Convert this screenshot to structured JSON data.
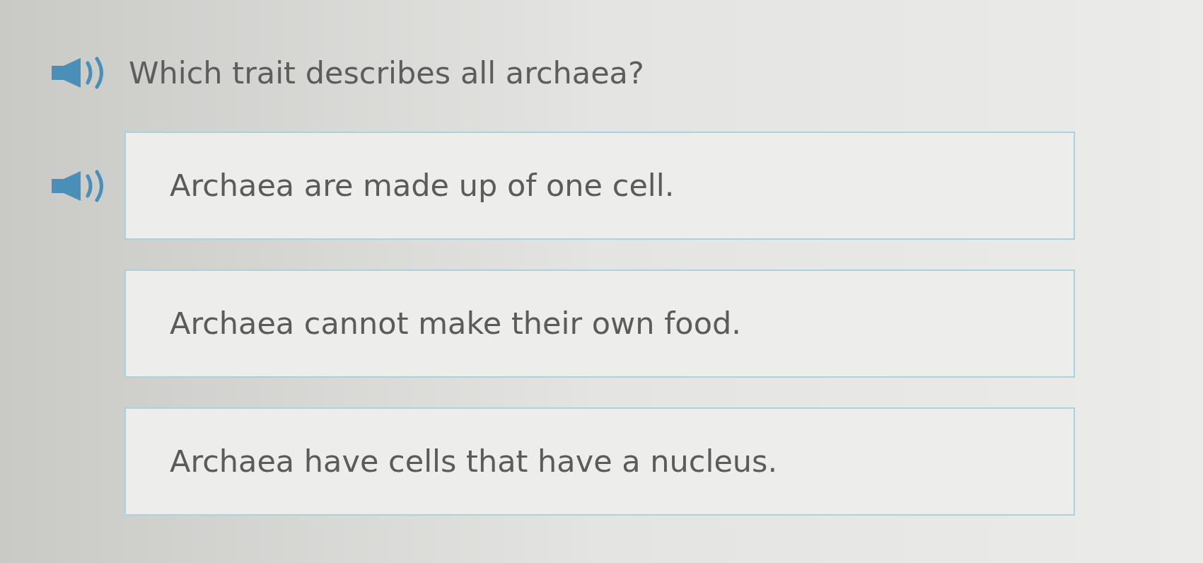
{
  "question": {
    "text": "Which trait describes all archaea?",
    "audio_button": true
  },
  "options": [
    {
      "text": "Archaea are made up of one cell.",
      "audio_button": true
    },
    {
      "text": "Archaea cannot make their own food.",
      "audio_button": false
    },
    {
      "text": "Archaea have cells that have a nucleus.",
      "audio_button": false
    }
  ]
}
